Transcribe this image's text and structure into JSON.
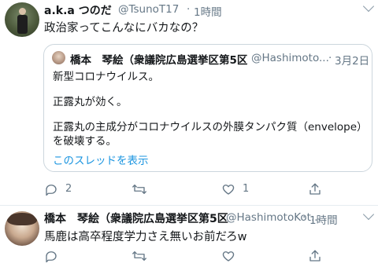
{
  "tweet1": {
    "display_name": "a.k.a つのだ",
    "handle": "@TsunoT17",
    "separator": "·",
    "time": "1時間",
    "text": "政治家ってこんなにバカなの？",
    "quoted": {
      "display_name": "橋本　琴絵（衆議院広島選挙区第5区",
      "handle": "@Hashimoto...",
      "separator": "·",
      "date": "3月2日",
      "lines": [
        "新型コロナウイルス。",
        "正露丸が効く。",
        "正露丸の主成分がコロナウイルスの外膜タンパク質（envelope）",
        "を破壊する。"
      ],
      "thread_link": "このスレッドを表示"
    },
    "actions": {
      "reply_count": "2",
      "retweet_count": "",
      "like_count": "1"
    }
  },
  "tweet2": {
    "display_name": "橋本　琴絵（衆議院広島選挙区第5区",
    "handle": "@HashimotoKot...",
    "separator": "·",
    "time": "1時間",
    "text": "馬鹿は高卒程度学力さえ無いお前だろw"
  },
  "icons": [
    "reply-icon",
    "retweet-icon",
    "like-icon",
    "share-icon",
    "chevron-down-icon"
  ],
  "colors": {
    "link": "#1b95e0",
    "secondary": "#657786",
    "border": "#ccd6dd"
  }
}
